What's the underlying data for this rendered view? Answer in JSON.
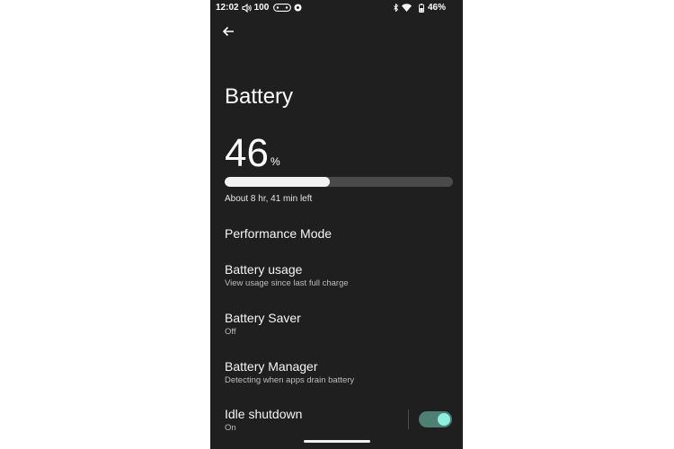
{
  "status_bar": {
    "time": "12:02",
    "volume": "100",
    "battery": "46%"
  },
  "header": {
    "back_icon": "arrow-left-icon",
    "title": "Battery"
  },
  "battery": {
    "level": "46",
    "unit": "%",
    "level_fraction": 0.46,
    "time_left": "About 8 hr, 41 min left"
  },
  "settings": {
    "performance_mode": {
      "title": "Performance Mode"
    },
    "battery_usage": {
      "title": "Battery usage",
      "subtitle": "View usage since last full charge"
    },
    "battery_saver": {
      "title": "Battery Saver",
      "subtitle": "Off"
    },
    "battery_manager": {
      "title": "Battery Manager",
      "subtitle": "Detecting when apps drain battery"
    },
    "idle_shutdown": {
      "title": "Idle shutdown",
      "subtitle": "On",
      "enabled": true
    }
  },
  "colors": {
    "background": "#1f1f1f",
    "bar_fill": "#f2f2f2",
    "bar_track": "#4a4a4a",
    "toggle_track": "#4e7f73",
    "toggle_thumb": "#8ef0dc"
  }
}
